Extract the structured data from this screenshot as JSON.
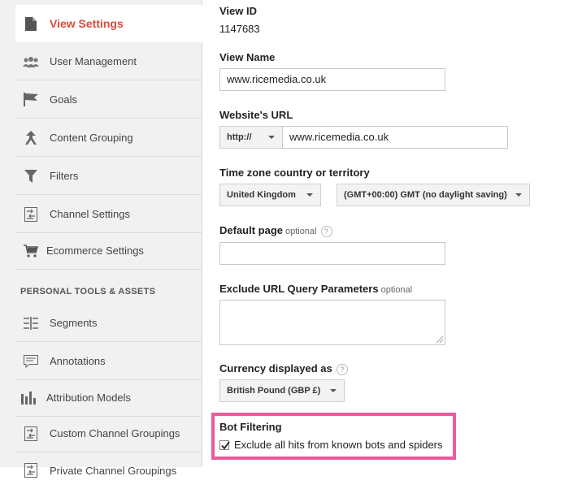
{
  "sidebar": {
    "items": [
      {
        "label": "View Settings",
        "icon": "document-icon",
        "active": true
      },
      {
        "label": "User Management",
        "icon": "users-icon"
      },
      {
        "label": "Goals",
        "icon": "flag-icon"
      },
      {
        "label": "Content Grouping",
        "icon": "merge-arrow-icon"
      },
      {
        "label": "Filters",
        "icon": "funnel-icon"
      },
      {
        "label": "Channel Settings",
        "icon": "channel-icon"
      },
      {
        "label": "Ecommerce Settings",
        "icon": "cart-icon"
      }
    ],
    "section_header": "PERSONAL TOOLS & ASSETS",
    "personal_items": [
      {
        "label": "Segments",
        "icon": "segments-icon"
      },
      {
        "label": "Annotations",
        "icon": "comment-icon"
      },
      {
        "label": "Attribution Models",
        "icon": "bar-chart-icon"
      },
      {
        "label": "Custom Channel Groupings",
        "icon": "channel-icon"
      },
      {
        "label": "Private Channel Groupings",
        "icon": "channel-icon"
      }
    ]
  },
  "form": {
    "view_id": {
      "label": "View ID",
      "value": "1147683"
    },
    "view_name": {
      "label": "View Name",
      "value": "www.ricemedia.co.uk"
    },
    "website_url": {
      "label": "Website's URL",
      "protocol": "http://",
      "value": "www.ricemedia.co.uk"
    },
    "timezone": {
      "label": "Time zone country or territory",
      "country": "United Kingdom",
      "zone": "(GMT+00:00) GMT (no daylight saving)"
    },
    "default_page": {
      "label": "Default page",
      "optional": "optional",
      "help": "?",
      "value": ""
    },
    "exclude_params": {
      "label": "Exclude URL Query Parameters",
      "optional": "optional",
      "value": ""
    },
    "currency": {
      "label": "Currency displayed as",
      "help": "?",
      "value": "British Pound (GBP £)"
    },
    "bot_filtering": {
      "label": "Bot Filtering",
      "checkbox_label": "Exclude all hits from known bots and spiders",
      "checked": true,
      "highlight_color": "#ec5a9c"
    }
  },
  "colors": {
    "accent": "#dd4b39",
    "highlight": "#ec5a9c"
  }
}
